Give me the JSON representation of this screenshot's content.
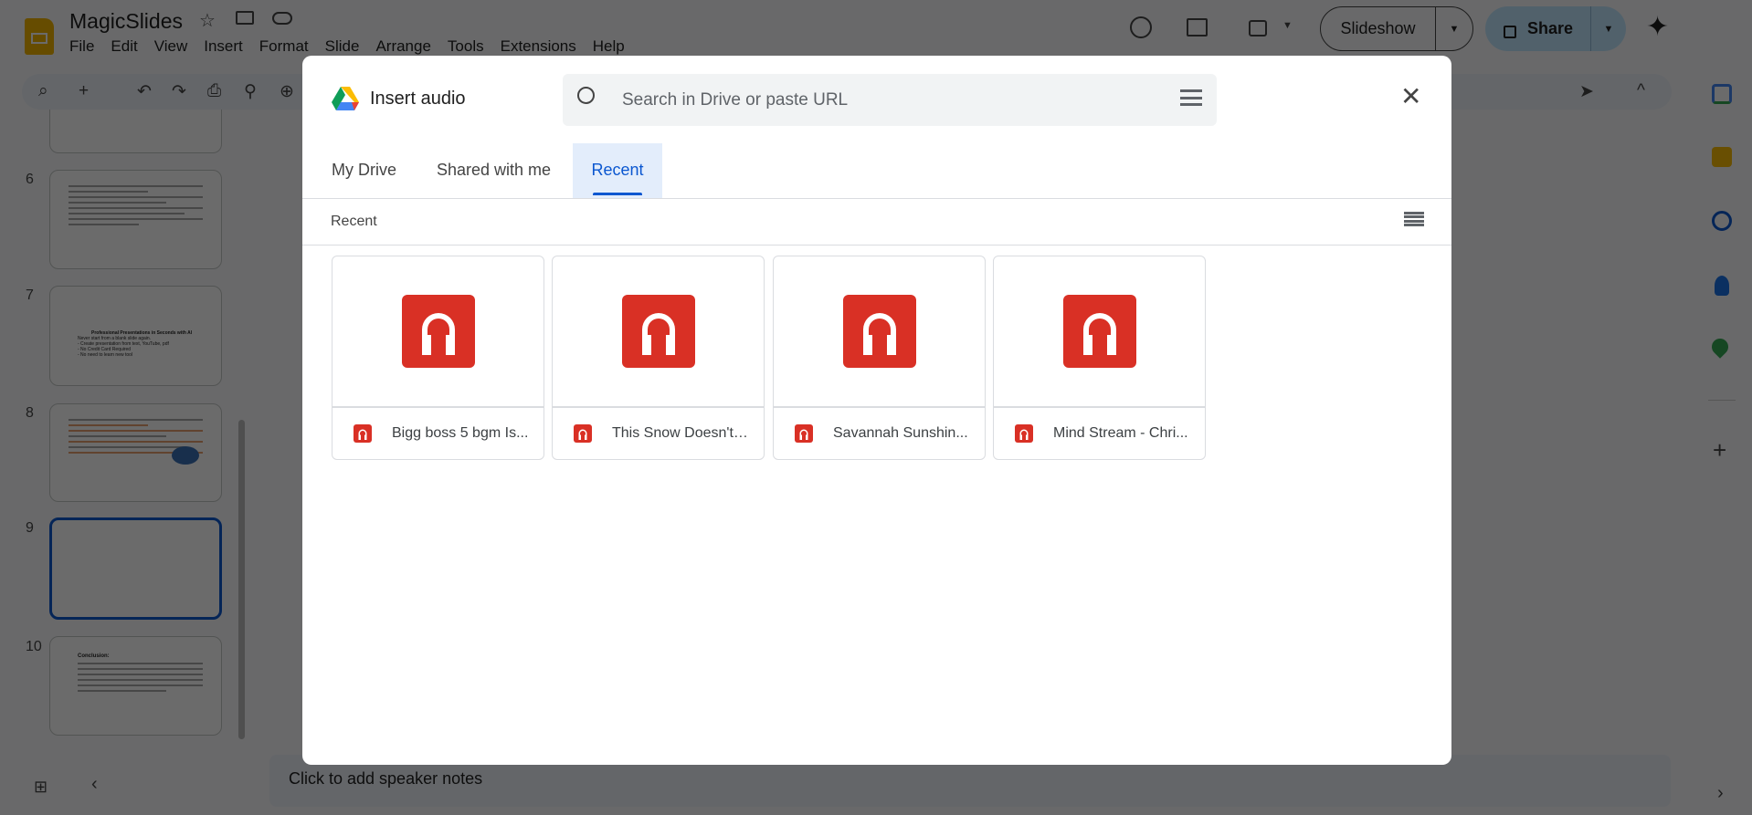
{
  "app": {
    "title": "MagicSlides",
    "menu": [
      "File",
      "Edit",
      "View",
      "Insert",
      "Format",
      "Slide",
      "Arrange",
      "Tools",
      "Extensions",
      "Help"
    ],
    "slideshow_label": "Slideshow",
    "share_label": "Share"
  },
  "slides": [
    {
      "number": "6"
    },
    {
      "number": "7",
      "title": "Professional Presentations in Seconds with AI",
      "lines": [
        "Never start from a blank slide again.",
        "- Create presentation from text, YouTube, pdf",
        "- No Credit Card Required",
        "- No need to learn new tool"
      ]
    },
    {
      "number": "8"
    },
    {
      "number": "9"
    },
    {
      "number": "10",
      "title": "Conclusion:"
    }
  ],
  "notes": {
    "placeholder": "Click to add speaker notes"
  },
  "dialog": {
    "title": "Insert audio",
    "search_placeholder": "Search in Drive or paste URL",
    "tabs": [
      "My Drive",
      "Shared with me",
      "Recent"
    ],
    "active_tab": "Recent",
    "section_label": "Recent",
    "files": [
      {
        "name": "Bigg boss 5 bgm Is..."
      },
      {
        "name": "This Snow Doesn't ..."
      },
      {
        "name": "Savannah Sunshin..."
      },
      {
        "name": "Mind Stream - Chri..."
      }
    ],
    "accent": "#0b57d0",
    "audio_color": "#d93025"
  }
}
